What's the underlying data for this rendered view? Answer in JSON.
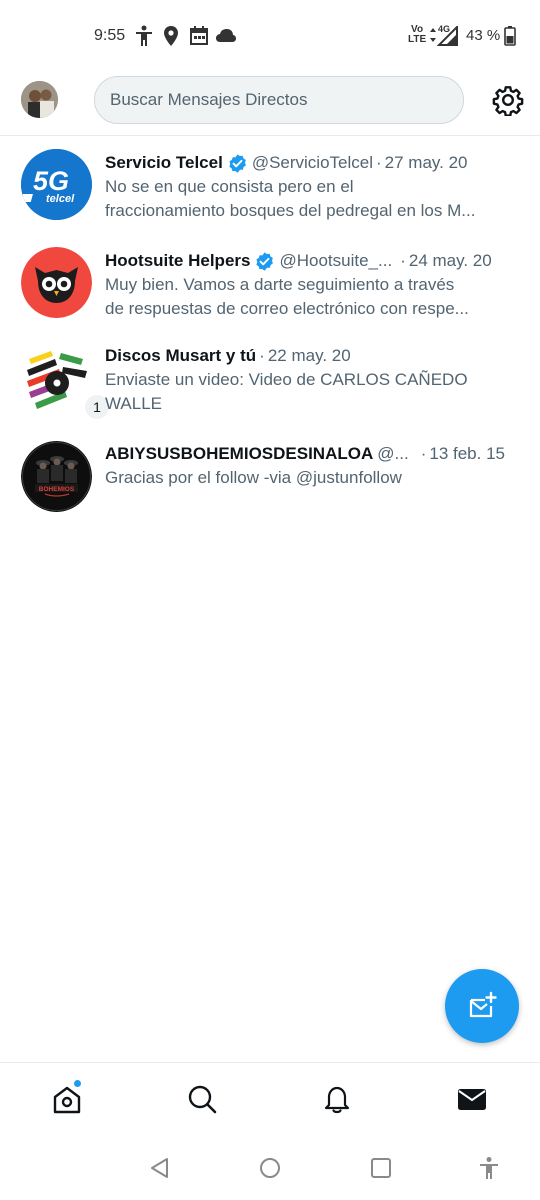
{
  "status_bar": {
    "time": "9:55",
    "network_label_top": "Vo",
    "network_label_bottom": "LTE",
    "network_type": "4G",
    "battery": "43 %"
  },
  "header": {
    "search_placeholder": "Buscar Mensajes Directos"
  },
  "conversations": [
    {
      "name": "Servicio Telcel",
      "verified": true,
      "handle": "@ServicioTelcel",
      "date": "27 may. 20",
      "message_line1": "No se en que consista pero en el",
      "message_line2": "fraccionamiento bosques del pedregal en los M...",
      "avatar_text": "5G",
      "avatar_subtext": "telcel"
    },
    {
      "name": "Hootsuite Helpers",
      "verified": true,
      "handle": "@Hootsuite_...",
      "date": "24 may. 20",
      "message_line1": "Muy bien. Vamos a darte seguimiento a través",
      "message_line2": "de respuestas de correo electrónico con respe..."
    },
    {
      "name": "Discos Musart y tú",
      "verified": false,
      "handle": "",
      "date": "22 may. 20",
      "message_line1": "Enviaste un video: Video de CARLOS CAÑEDO",
      "message_line2": "WALLE",
      "unread_count": "1"
    },
    {
      "name": "ABIYSUSBOHEMIOSDESINALOA",
      "verified": false,
      "handle": "@...",
      "date": "13 feb. 15",
      "message_line1": "Gracias por el follow -via @justunfollow",
      "message_line2": "",
      "avatar_text": "BOHEMIOS"
    }
  ],
  "colors": {
    "accent": "#1d9bf0",
    "text_primary": "#0f1419",
    "text_secondary": "#536471"
  }
}
